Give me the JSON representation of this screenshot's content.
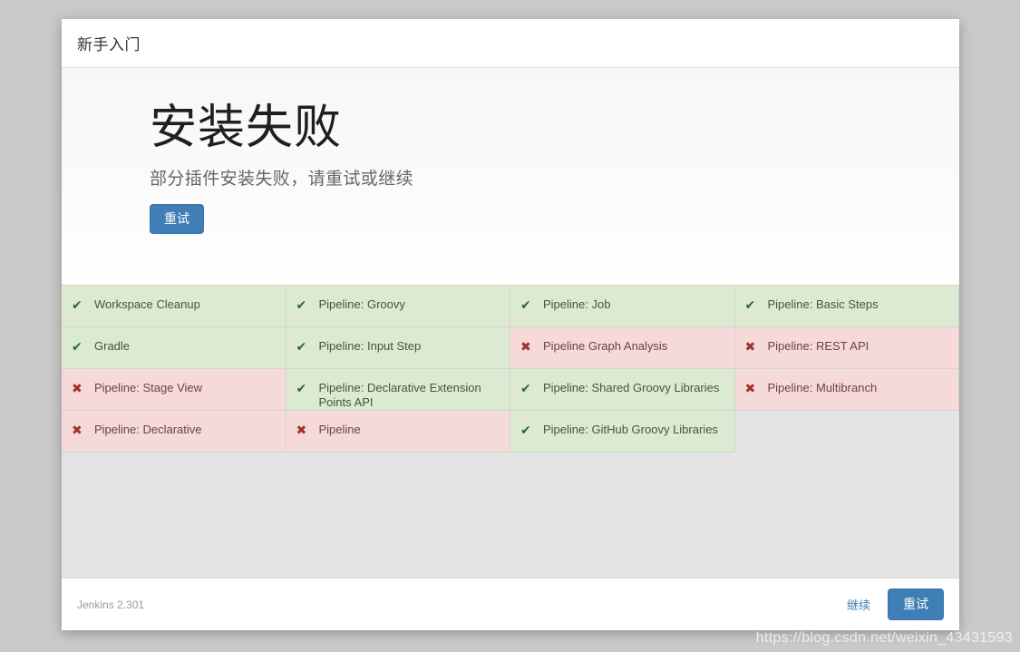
{
  "header": {
    "title": "新手入门"
  },
  "hero": {
    "heading": "安装失败",
    "subtitle": "部分插件安装失败，请重试或继续",
    "retry_label": "重试"
  },
  "plugins": [
    {
      "name": "Workspace Cleanup",
      "status": "success",
      "icon": "check-icon"
    },
    {
      "name": "Pipeline: Groovy",
      "status": "success",
      "icon": "check-icon"
    },
    {
      "name": "Pipeline: Job",
      "status": "success",
      "icon": "check-icon"
    },
    {
      "name": "Pipeline: Basic Steps",
      "status": "success",
      "icon": "check-icon"
    },
    {
      "name": "Gradle",
      "status": "success",
      "icon": "check-icon"
    },
    {
      "name": "Pipeline: Input Step",
      "status": "success",
      "icon": "check-icon"
    },
    {
      "name": "Pipeline Graph Analysis",
      "status": "failure",
      "icon": "cross-icon"
    },
    {
      "name": "Pipeline: REST API",
      "status": "failure",
      "icon": "cross-icon"
    },
    {
      "name": "Pipeline: Stage View",
      "status": "failure",
      "icon": "cross-icon"
    },
    {
      "name": "Pipeline: Declarative Extension Points API",
      "status": "success",
      "icon": "check-icon"
    },
    {
      "name": "Pipeline: Shared Groovy Libraries",
      "status": "success",
      "icon": "check-icon"
    },
    {
      "name": "Pipeline: Multibranch",
      "status": "failure",
      "icon": "cross-icon"
    },
    {
      "name": "Pipeline: Declarative",
      "status": "failure",
      "icon": "cross-icon"
    },
    {
      "name": "Pipeline",
      "status": "failure",
      "icon": "cross-icon"
    },
    {
      "name": "Pipeline: GitHub Groovy Libraries",
      "status": "success",
      "icon": "check-icon"
    },
    {
      "name": "",
      "status": "empty",
      "icon": ""
    }
  ],
  "icons": {
    "check": "✔",
    "cross": "✖"
  },
  "footer": {
    "version": "Jenkins 2.301",
    "continue_label": "继续",
    "retry_label": "重试"
  },
  "watermark": {
    "text": "https://blog.csdn.net/weixin_43431593"
  },
  "colors": {
    "accent": "#3f7fb5",
    "success_bg": "#dcead2",
    "failure_bg": "#f6d9d9",
    "success_icon": "#2b6b2b",
    "failure_icon": "#a32f2f",
    "page_bg": "#c9c9c9"
  }
}
